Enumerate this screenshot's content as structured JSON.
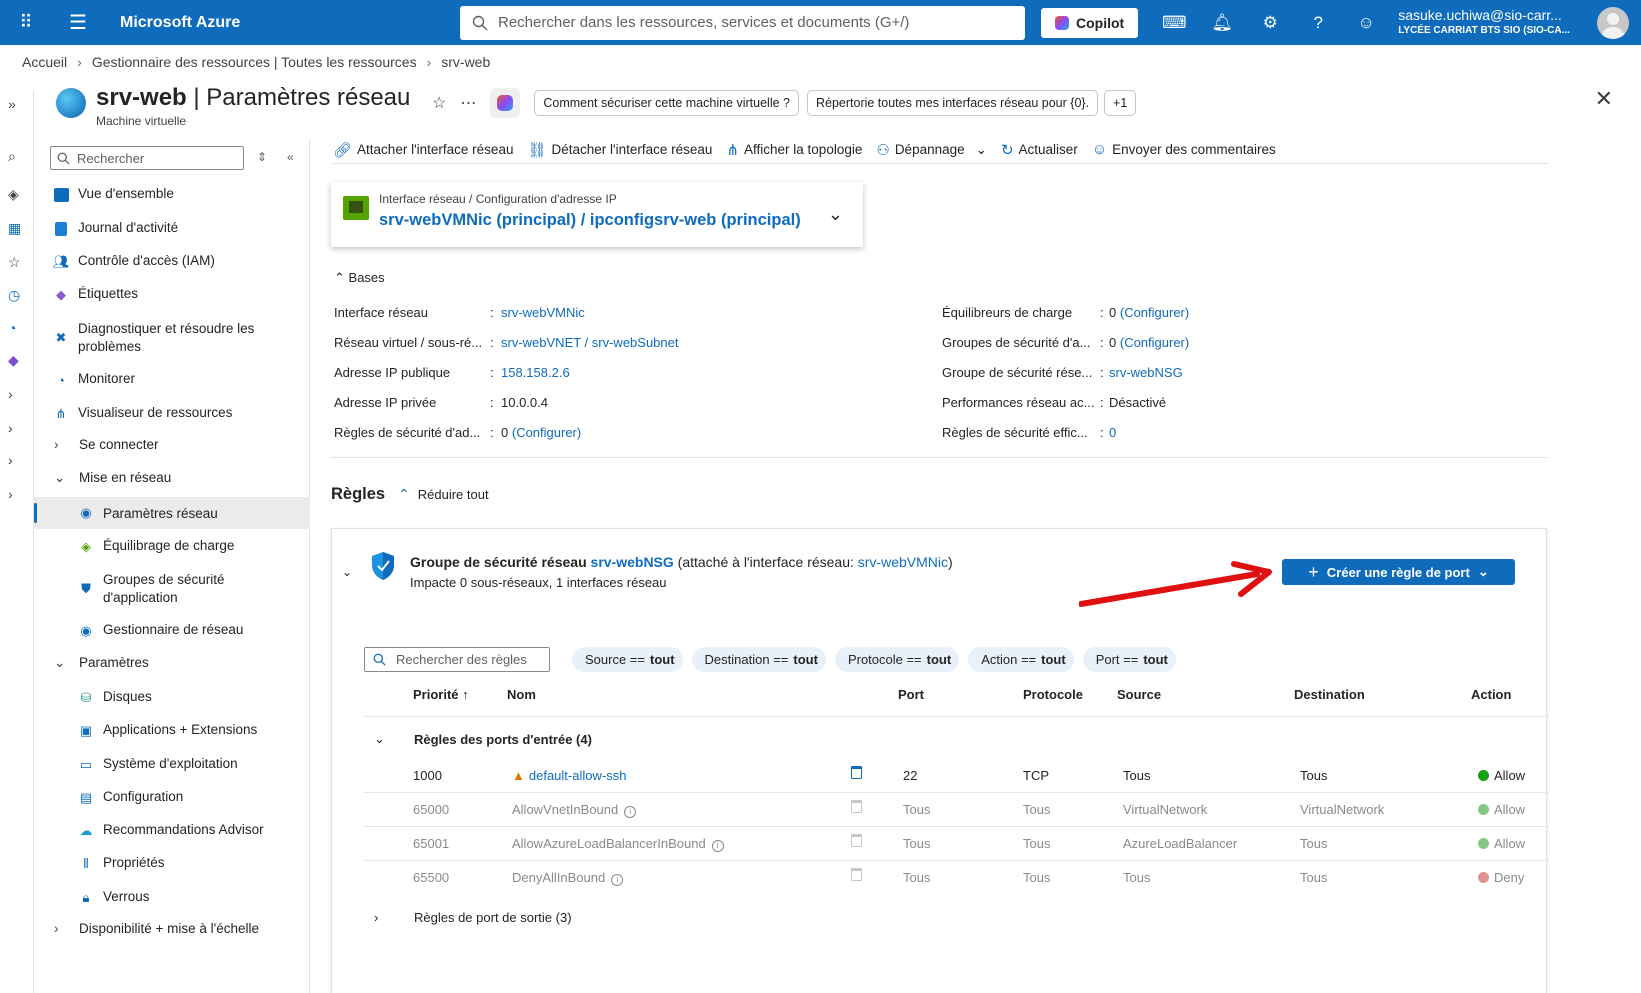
{
  "topbar": {
    "brand": "Microsoft Azure",
    "search_placeholder": "Rechercher dans les ressources, services et documents (G+/)",
    "copilot_label": "Copilot",
    "account_email": "sasuke.uchiwa@sio-carr...",
    "account_org": "LYCÉE CARRIAT BTS SIO (SIO-CA..."
  },
  "breadcrumb": [
    "Accueil",
    "Gestionnaire des ressources | Toutes les ressources",
    "srv-web"
  ],
  "page": {
    "title_bold": "srv-web",
    "title_rest": " | Paramètres réseau",
    "subtitle": "Machine virtuelle",
    "suggestions": [
      "Comment sécuriser cette machine virtuelle ?",
      "Répertorie toutes mes interfaces réseau pour {0}.",
      "+1"
    ]
  },
  "sidemenu": {
    "search_placeholder": "Rechercher",
    "items": {
      "overview": "Vue d'ensemble",
      "activity": "Journal d'activité",
      "iam": "Contrôle d'accès (IAM)",
      "tags": "Étiquettes",
      "diagnose": "Diagnostiquer et résoudre les problèmes",
      "monitor": "Monitorer",
      "visualizer": "Visualiseur de ressources",
      "connect": "Se connecter",
      "networking": "Mise en réseau",
      "net_settings": "Paramètres réseau",
      "load_balancing": "Équilibrage de charge",
      "asg": "Groupes de sécurité d'application",
      "net_manager": "Gestionnaire de réseau",
      "settings": "Paramètres",
      "disks": "Disques",
      "extensions": "Applications + Extensions",
      "os": "Système d'exploitation",
      "configuration": "Configuration",
      "advisor": "Recommandations Advisor",
      "properties": "Propriétés",
      "locks": "Verrous",
      "availability": "Disponibilité + mise à l'échelle"
    }
  },
  "toolbar": {
    "attach": "Attacher l'interface réseau",
    "detach": "Détacher l'interface réseau",
    "topology": "Afficher la topologie",
    "troubleshoot": "Dépannage",
    "refresh": "Actualiser",
    "feedback": "Envoyer des commentaires"
  },
  "nic_selector": {
    "label": "Interface réseau / Configuration d'adresse IP",
    "value": "srv-webVMNic (principal) / ipconfigsrv-web (principal)"
  },
  "essentials": {
    "toggle": "Bases",
    "left": [
      {
        "key": "Interface réseau",
        "value": "srv-webVMNic",
        "link": true
      },
      {
        "key": "Réseau virtuel / sous-ré...",
        "value": "srv-webVNET / srv-webSubnet",
        "link": true
      },
      {
        "key": "Adresse IP publique",
        "value": "158.158.2.6",
        "link": true
      },
      {
        "key": "Adresse IP privée",
        "value": "10.0.0.4",
        "link": false
      },
      {
        "key": "Règles de sécurité d'ad...",
        "value": "0",
        "extra": "(Configurer)"
      }
    ],
    "right": [
      {
        "key": "Équilibreurs de charge",
        "value": "0",
        "extra": "(Configurer)"
      },
      {
        "key": "Groupes de sécurité d'a...",
        "value": "0",
        "extra": "(Configurer)"
      },
      {
        "key": "Groupe de sécurité rése...",
        "value": "srv-webNSG",
        "link": true
      },
      {
        "key": "Performances réseau ac...",
        "value": "Désactivé",
        "link": false
      },
      {
        "key": "Règles de sécurité effic...",
        "value": "0",
        "link": true
      }
    ]
  },
  "rules": {
    "title": "Règles",
    "collapse_all": "Réduire tout",
    "nsg": {
      "prefix": "Groupe de sécurité réseau ",
      "name": "srv-webNSG",
      "attached_prefix": " (attaché à l'interface réseau: ",
      "attached_nic": "srv-webVMNic",
      "attached_suffix": ")",
      "impact": "Impacte 0 sous-réseaux, 1 interfaces réseau",
      "create_button": "Créer une règle de port"
    },
    "search_placeholder": "Rechercher des règles",
    "filters": [
      {
        "label": "Source ==",
        "value": "tout"
      },
      {
        "label": "Destination ==",
        "value": "tout"
      },
      {
        "label": "Protocole ==",
        "value": "tout"
      },
      {
        "label": "Action ==",
        "value": "tout"
      },
      {
        "label": "Port ==",
        "value": "tout"
      }
    ],
    "columns": {
      "priority": "Priorité ↑",
      "name": "Nom",
      "port": "Port",
      "protocol": "Protocole",
      "source": "Source",
      "destination": "Destination",
      "action": "Action"
    },
    "inbound_group": "Règles des ports d'entrée (4)",
    "outbound_group": "Règles de port de sortie (3)",
    "inbound": [
      {
        "priority": "1000",
        "name": "default-allow-ssh",
        "port": "22",
        "protocol": "TCP",
        "source": "Tous",
        "destination": "Tous",
        "action": "Allow"
      },
      {
        "priority": "65000",
        "name": "AllowVnetInBound",
        "port": "Tous",
        "protocol": "Tous",
        "source": "VirtualNetwork",
        "destination": "VirtualNetwork",
        "action": "Allow"
      },
      {
        "priority": "65001",
        "name": "AllowAzureLoadBalancerInBound",
        "port": "Tous",
        "protocol": "Tous",
        "source": "AzureLoadBalancer",
        "destination": "Tous",
        "action": "Allow"
      },
      {
        "priority": "65500",
        "name": "DenyAllInBound",
        "port": "Tous",
        "protocol": "Tous",
        "source": "Tous",
        "destination": "Tous",
        "action": "Deny"
      }
    ]
  },
  "colors": {
    "brand": "#0f6cbd",
    "allow": "#13a10e",
    "deny": "#d13438",
    "annotation_arrow": "#e01010"
  }
}
